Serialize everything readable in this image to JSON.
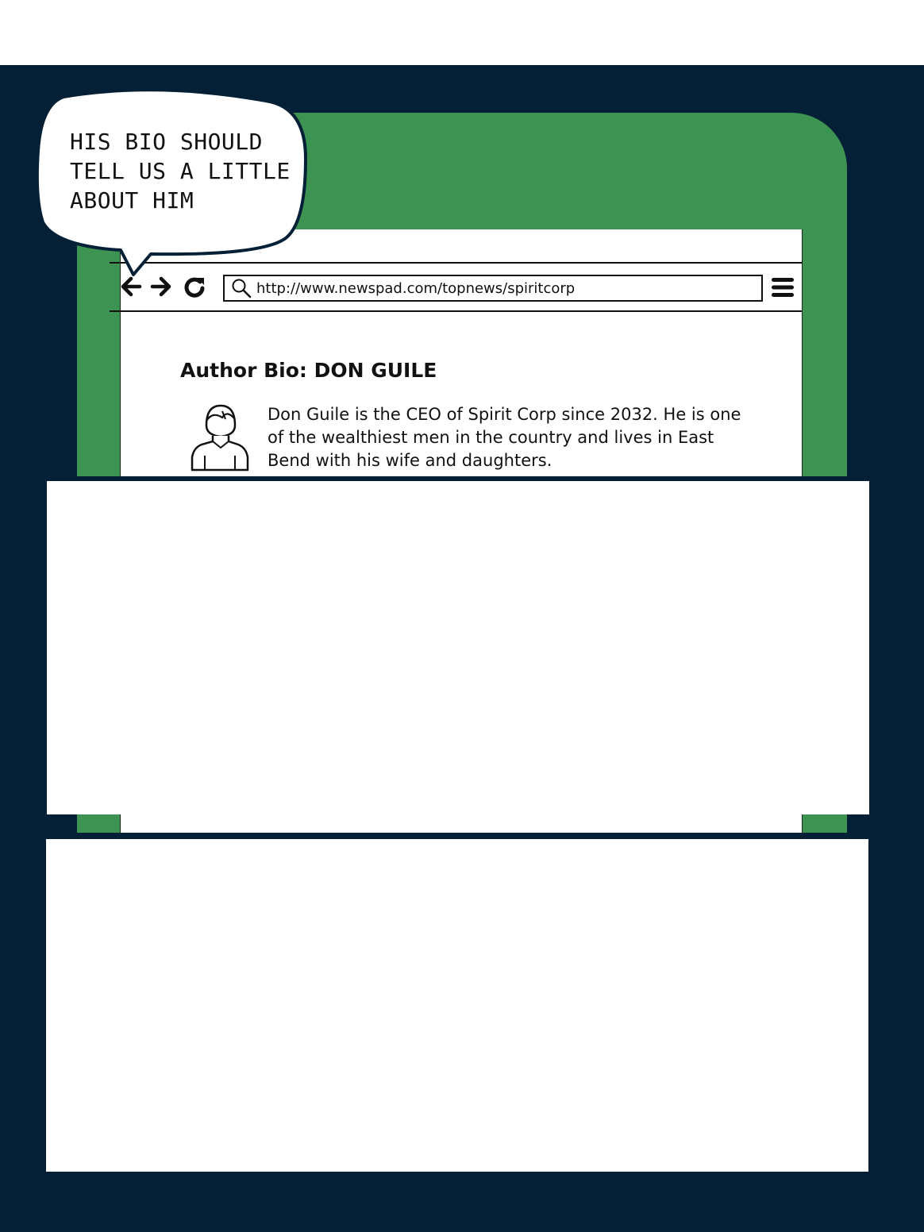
{
  "speech_bubble": {
    "lines": [
      "His bio should",
      "tell us a little",
      "about him"
    ]
  },
  "browser": {
    "url": "http://www.newspad.com/topnews/spiritcorp",
    "nav_icons": [
      "back-arrow-icon",
      "forward-arrow-icon",
      "refresh-icon",
      "search-icon",
      "menu-icon"
    ]
  },
  "author_bio": {
    "title": "Author Bio: DON GUILE",
    "text": "Don Guile is the CEO of Spirit Corp since 2032. He is one of the wealthiest men in the country and lives in East Bend with his wife and daughters.",
    "avatar_icon": "person-icon"
  },
  "colors": {
    "background": "#042036",
    "tablet": "#3d9452",
    "panel": "#ffffff"
  }
}
